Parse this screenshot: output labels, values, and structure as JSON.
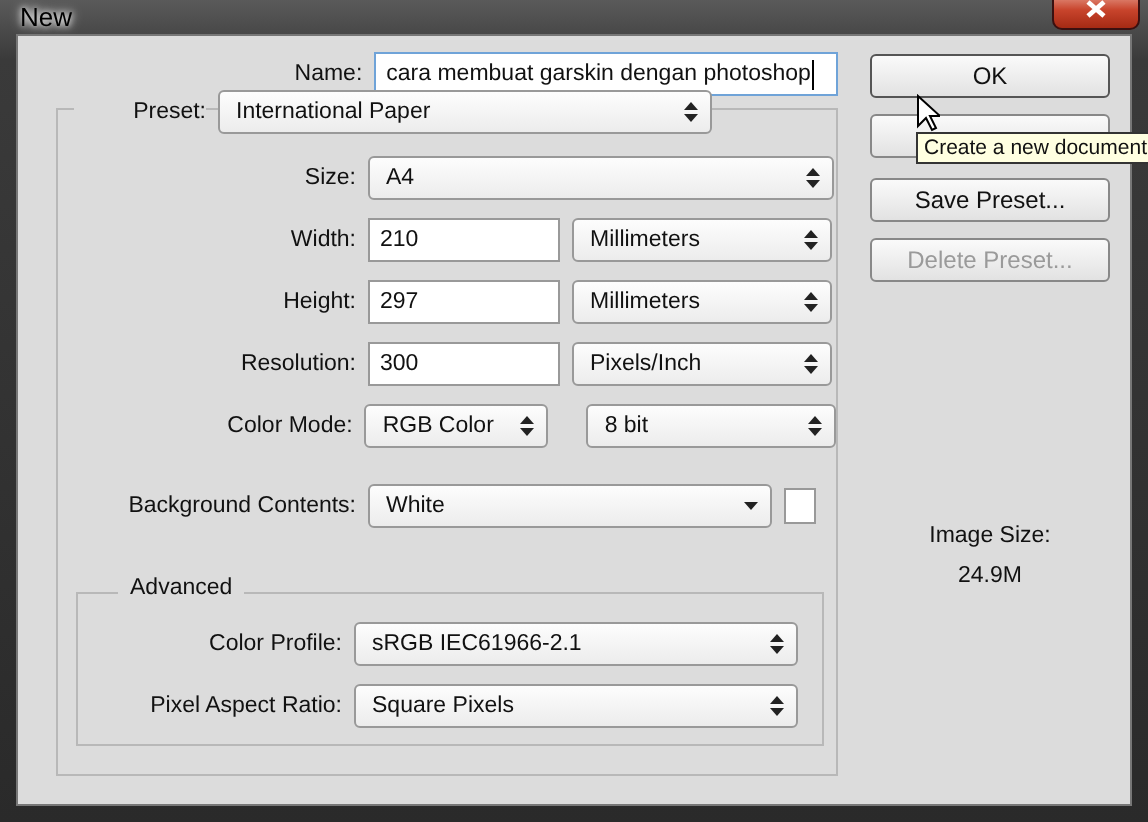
{
  "window": {
    "title": "New"
  },
  "name": {
    "label": "Name:",
    "value": "cara membuat garskin dengan photoshop",
    "focused": true
  },
  "preset": {
    "label": "Preset:",
    "value": "International Paper"
  },
  "fields": [
    {
      "kind": "select",
      "label": "Size:",
      "value": "A4"
    },
    {
      "kind": "input_select",
      "label": "Width:",
      "value": "210",
      "unit": "Millimeters"
    },
    {
      "kind": "input_select",
      "label": "Height:",
      "value": "297",
      "unit": "Millimeters"
    },
    {
      "kind": "input_select",
      "label": "Resolution:",
      "value": "300",
      "unit": "Pixels/Inch"
    },
    {
      "kind": "select_pair",
      "label": "Color Mode:",
      "value": "RGB Color",
      "unit": "8 bit"
    }
  ],
  "background": {
    "label": "Background Contents:",
    "value": "White"
  },
  "advanced": {
    "title": "Advanced",
    "fields": [
      {
        "label": "Color Profile:",
        "value": "sRGB IEC61966-2.1"
      },
      {
        "label": "Pixel Aspect Ratio:",
        "value": "Square Pixels"
      }
    ]
  },
  "buttons": [
    {
      "label": "OK",
      "disabled": false,
      "default": true
    },
    {
      "covered": true
    },
    {
      "label": "Save Preset...",
      "disabled": false,
      "default": false
    },
    {
      "label": "Delete Preset...",
      "disabled": true,
      "default": false
    }
  ],
  "tooltip": {
    "text": "Create a new document"
  },
  "image_size": {
    "label": "Image Size:",
    "value": "24.9M"
  }
}
